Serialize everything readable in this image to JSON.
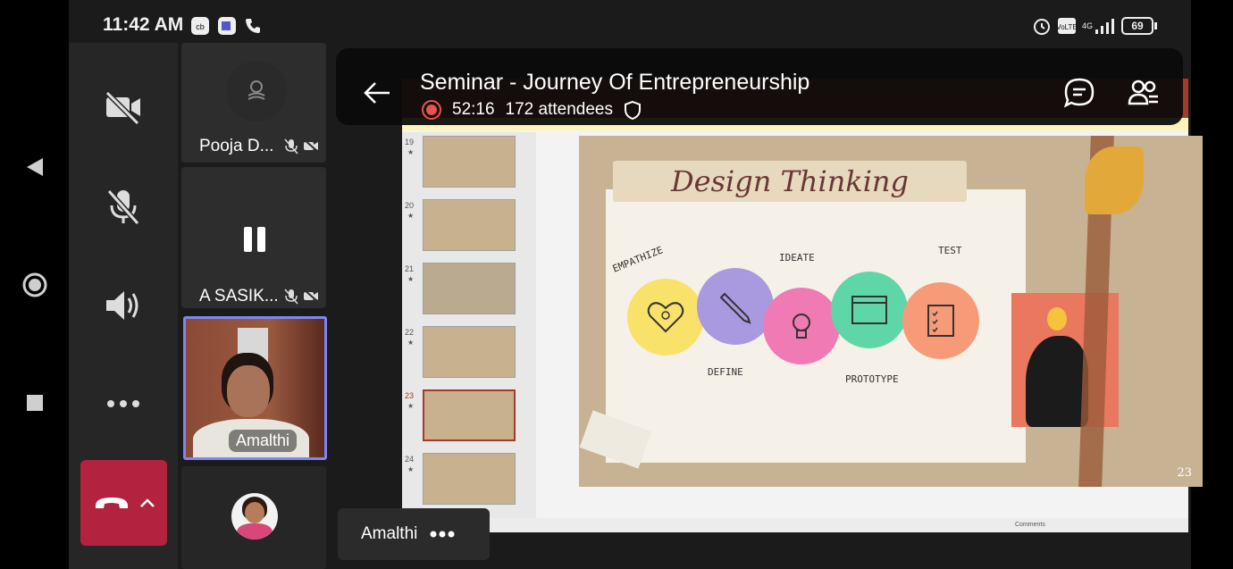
{
  "status_bar": {
    "time": "11:42 AM",
    "battery": "69",
    "network": "4G"
  },
  "android_nav": {
    "back_icon": "triangle-back-icon",
    "home_icon": "circle-home-icon",
    "recents_icon": "square-recents-icon"
  },
  "controls": {
    "camera_icon": "camera-off-icon",
    "mic_icon": "mic-off-icon",
    "speaker_icon": "speaker-icon",
    "more_icon": "more-icon",
    "end_call_icon": "hang-up-icon",
    "end_call_color": "#b3223f"
  },
  "participants": [
    {
      "name": "Pooja D...",
      "type": "initials"
    },
    {
      "name": "A SASIK...",
      "type": "paused"
    },
    {
      "name": "Amalthi",
      "type": "video"
    },
    {
      "name": "",
      "type": "avatar"
    }
  ],
  "meeting": {
    "title": "Seminar - Journey Of Entrepreneurship",
    "duration": "52:16",
    "attendees": "172 attendees",
    "presenter": "Amalthi"
  },
  "slide": {
    "heading": "Design Thinking",
    "stages": [
      {
        "label": "EMPATHIZE",
        "color": "#f9e26a"
      },
      {
        "label": "DEFINE",
        "color": "#a99ae0"
      },
      {
        "label": "IDEATE",
        "color": "#f07ab3"
      },
      {
        "label": "PROTOTYPE",
        "color": "#5fd6a8"
      },
      {
        "label": "TEST",
        "color": "#f79a78"
      }
    ],
    "number": "23"
  },
  "thumbnails": [
    {
      "num": "19"
    },
    {
      "num": "20"
    },
    {
      "num": "21"
    },
    {
      "num": "22"
    },
    {
      "num": "23"
    },
    {
      "num": "24"
    }
  ],
  "ppt_status": {
    "comments": "Comments"
  }
}
